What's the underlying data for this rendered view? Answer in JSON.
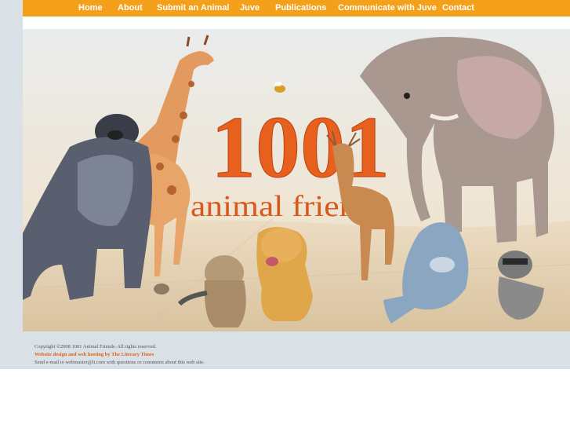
{
  "nav": {
    "items": [
      {
        "label": "Home"
      },
      {
        "label": "About"
      },
      {
        "label": "Submit an Animal"
      },
      {
        "label": "Juve"
      },
      {
        "label": "Publications"
      },
      {
        "label": "Communicate with Juve"
      },
      {
        "label": "Contact"
      }
    ]
  },
  "hero": {
    "title_number": "1001",
    "title_text": "animal friends"
  },
  "footer": {
    "copyright": "Copyright ©2008 1001 Animal Friends. All rights reserved.",
    "credit_link": "Website design and web hosting by The Literary Times",
    "contact_text": "Send e-mail to webmaster@lt.com with questions or comments about this web site."
  },
  "colors": {
    "nav_bg": "#f4a01b",
    "page_bg": "#d9e0e6",
    "title_orange": "#e8601e"
  }
}
